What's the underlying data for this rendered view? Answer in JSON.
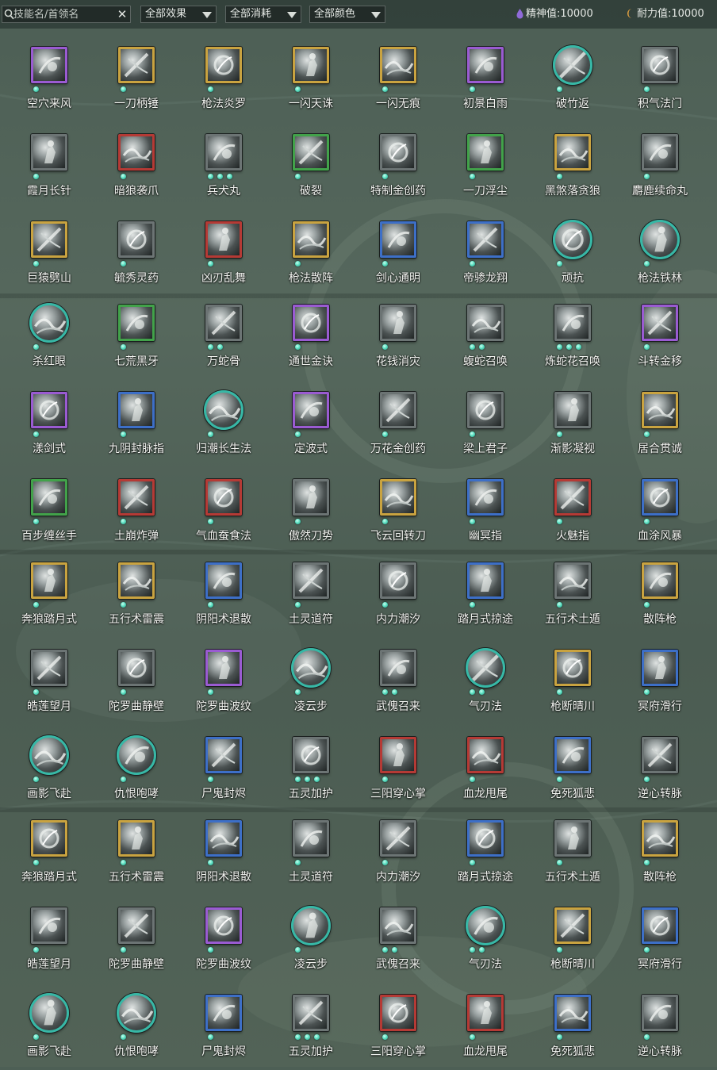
{
  "toolbar": {
    "search_placeholder": "技能名/首领名",
    "clear_label": "✕",
    "filters": [
      {
        "label": "全部效果"
      },
      {
        "label": "全部消耗"
      },
      {
        "label": "全部颜色"
      }
    ],
    "spirit_label": "精神值:",
    "spirit_value": "10000",
    "endurance_label": "耐力值:",
    "endurance_value": "10000",
    "colors": {
      "spirit": "#8f6ad8",
      "endurance": "#e0a040"
    }
  },
  "frame_colors": {
    "purple": "#9a5bd2",
    "gold": "#c9a340",
    "green": "#42a24a",
    "red": "#b53a35",
    "blue": "#3d6fc7",
    "grey": "#6c7474",
    "teal": "#37b8a6"
  },
  "skills": [
    {
      "name": "空穴来风",
      "frame": "purple",
      "dots": 1
    },
    {
      "name": "一刀柄锤",
      "frame": "gold",
      "dots": 1
    },
    {
      "name": "枪法炎罗",
      "frame": "gold",
      "dots": 1
    },
    {
      "name": "一闪天诛",
      "frame": "gold",
      "dots": 1
    },
    {
      "name": "一闪无痕",
      "frame": "gold",
      "dots": 1
    },
    {
      "name": "初景白雨",
      "frame": "purple",
      "dots": 1
    },
    {
      "name": "破竹返",
      "frame": "teal",
      "dots": 1
    },
    {
      "name": "积气法门",
      "frame": "grey",
      "dots": 1
    },
    {
      "name": "霞月长针",
      "frame": "grey",
      "dots": 1
    },
    {
      "name": "暗狼袭爪",
      "frame": "red",
      "dots": 1
    },
    {
      "name": "兵犬丸",
      "frame": "grey",
      "dots": 3
    },
    {
      "name": "破裂",
      "frame": "green",
      "dots": 1
    },
    {
      "name": "特制金创药",
      "frame": "grey",
      "dots": 1
    },
    {
      "name": "一刀浮尘",
      "frame": "green",
      "dots": 1
    },
    {
      "name": "黑煞落贪狼",
      "frame": "gold",
      "dots": 1
    },
    {
      "name": "麝鹿续命丸",
      "frame": "grey",
      "dots": 1
    },
    {
      "name": "巨猿劈山",
      "frame": "gold",
      "dots": 1
    },
    {
      "name": "毓秀灵药",
      "frame": "grey",
      "dots": 1
    },
    {
      "name": "凶刃乱舞",
      "frame": "red",
      "dots": 1
    },
    {
      "name": "枪法散阵",
      "frame": "gold",
      "dots": 1
    },
    {
      "name": "剑心通明",
      "frame": "blue",
      "dots": 1
    },
    {
      "name": "帝骖龙翔",
      "frame": "blue",
      "dots": 1
    },
    {
      "name": "顽抗",
      "frame": "teal",
      "dots": 1
    },
    {
      "name": "枪法铁林",
      "frame": "teal",
      "dots": 1
    },
    {
      "name": "杀红眼",
      "frame": "teal",
      "dots": 1
    },
    {
      "name": "七荒黑牙",
      "frame": "green",
      "dots": 1
    },
    {
      "name": "万蛇骨",
      "frame": "grey",
      "dots": 2
    },
    {
      "name": "通世金诀",
      "frame": "purple",
      "dots": 1
    },
    {
      "name": "花钱消灾",
      "frame": "grey",
      "dots": 1
    },
    {
      "name": "蝮蛇召唤",
      "frame": "grey",
      "dots": 2
    },
    {
      "name": "炼蛇花召唤",
      "frame": "grey",
      "dots": 3
    },
    {
      "name": "斗转金移",
      "frame": "purple",
      "dots": 1
    },
    {
      "name": "漾剑式",
      "frame": "purple",
      "dots": 1
    },
    {
      "name": "九阴封脉指",
      "frame": "blue",
      "dots": 1
    },
    {
      "name": "归潮长生法",
      "frame": "teal",
      "dots": 1
    },
    {
      "name": "定波式",
      "frame": "purple",
      "dots": 1
    },
    {
      "name": "万花金创药",
      "frame": "grey",
      "dots": 1
    },
    {
      "name": "梁上君子",
      "frame": "grey",
      "dots": 1
    },
    {
      "name": "渐影凝视",
      "frame": "grey",
      "dots": 1
    },
    {
      "name": "居合贯诚",
      "frame": "gold",
      "dots": 1
    },
    {
      "name": "百步缠丝手",
      "frame": "green",
      "dots": 1
    },
    {
      "name": "土崩炸弹",
      "frame": "red",
      "dots": 1
    },
    {
      "name": "气血蚕食法",
      "frame": "red",
      "dots": 1
    },
    {
      "name": "傲然刀势",
      "frame": "grey",
      "dots": 1
    },
    {
      "name": "飞云回转刀",
      "frame": "gold",
      "dots": 1
    },
    {
      "name": "幽冥指",
      "frame": "blue",
      "dots": 1
    },
    {
      "name": "火魅指",
      "frame": "red",
      "dots": 1
    },
    {
      "name": "血涂风暴",
      "frame": "blue",
      "dots": 1
    },
    {
      "name": "奔狼踏月式",
      "frame": "gold",
      "dots": 1
    },
    {
      "name": "五行术雷震",
      "frame": "gold",
      "dots": 1
    },
    {
      "name": "阴阳术退散",
      "frame": "blue",
      "dots": 1
    },
    {
      "name": "土灵道符",
      "frame": "grey",
      "dots": 1
    },
    {
      "name": "内力潮汐",
      "frame": "grey",
      "dots": 1
    },
    {
      "name": "踏月式掠途",
      "frame": "blue",
      "dots": 1
    },
    {
      "name": "五行术土遁",
      "frame": "grey",
      "dots": 1
    },
    {
      "name": "散阵枪",
      "frame": "gold",
      "dots": 1
    },
    {
      "name": "皓莲望月",
      "frame": "grey",
      "dots": 1
    },
    {
      "name": "陀罗曲静壁",
      "frame": "grey",
      "dots": 1
    },
    {
      "name": "陀罗曲波纹",
      "frame": "purple",
      "dots": 1
    },
    {
      "name": "凌云步",
      "frame": "teal",
      "dots": 1
    },
    {
      "name": "武傀召来",
      "frame": "grey",
      "dots": 2
    },
    {
      "name": "气刃法",
      "frame": "teal",
      "dots": 2
    },
    {
      "name": "枪断晴川",
      "frame": "gold",
      "dots": 1
    },
    {
      "name": "冥府滑行",
      "frame": "blue",
      "dots": 1
    },
    {
      "name": "画影飞赴",
      "frame": "teal",
      "dots": 1
    },
    {
      "name": "仇恨咆哮",
      "frame": "teal",
      "dots": 1
    },
    {
      "name": "尸鬼封烬",
      "frame": "blue",
      "dots": 1
    },
    {
      "name": "五灵加护",
      "frame": "grey",
      "dots": 3
    },
    {
      "name": "三阳穿心掌",
      "frame": "red",
      "dots": 1
    },
    {
      "name": "血龙甩尾",
      "frame": "red",
      "dots": 1
    },
    {
      "name": "免死狐悲",
      "frame": "blue",
      "dots": 1
    },
    {
      "name": "逆心转脉",
      "frame": "grey",
      "dots": 1
    },
    {
      "name": "奔狼踏月式",
      "frame": "gold",
      "dots": 1
    },
    {
      "name": "五行术雷震",
      "frame": "gold",
      "dots": 1
    },
    {
      "name": "阴阳术退散",
      "frame": "blue",
      "dots": 1
    },
    {
      "name": "土灵道符",
      "frame": "grey",
      "dots": 1
    },
    {
      "name": "内力潮汐",
      "frame": "grey",
      "dots": 1
    },
    {
      "name": "踏月式掠途",
      "frame": "blue",
      "dots": 1
    },
    {
      "name": "五行术土遁",
      "frame": "grey",
      "dots": 1
    },
    {
      "name": "散阵枪",
      "frame": "gold",
      "dots": 1
    },
    {
      "name": "皓莲望月",
      "frame": "grey",
      "dots": 1
    },
    {
      "name": "陀罗曲静壁",
      "frame": "grey",
      "dots": 1
    },
    {
      "name": "陀罗曲波纹",
      "frame": "purple",
      "dots": 1
    },
    {
      "name": "凌云步",
      "frame": "teal",
      "dots": 1
    },
    {
      "name": "武傀召来",
      "frame": "grey",
      "dots": 2
    },
    {
      "name": "气刃法",
      "frame": "teal",
      "dots": 2
    },
    {
      "name": "枪断晴川",
      "frame": "gold",
      "dots": 1
    },
    {
      "name": "冥府滑行",
      "frame": "blue",
      "dots": 1
    },
    {
      "name": "画影飞赴",
      "frame": "teal",
      "dots": 1
    },
    {
      "name": "仇恨咆哮",
      "frame": "teal",
      "dots": 1
    },
    {
      "name": "尸鬼封烬",
      "frame": "blue",
      "dots": 1
    },
    {
      "name": "五灵加护",
      "frame": "grey",
      "dots": 3
    },
    {
      "name": "三阳穿心掌",
      "frame": "red",
      "dots": 1
    },
    {
      "name": "血龙甩尾",
      "frame": "red",
      "dots": 1
    },
    {
      "name": "免死狐悲",
      "frame": "blue",
      "dots": 1
    },
    {
      "name": "逆心转脉",
      "frame": "grey",
      "dots": 1
    }
  ]
}
